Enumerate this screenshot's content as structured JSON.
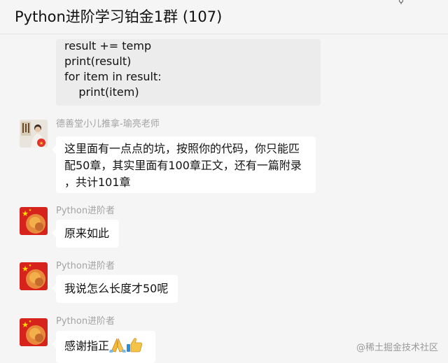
{
  "header": {
    "title": "Python进阶学习铂金1群 (107)"
  },
  "code_message": {
    "lines": [
      "result += temp",
      "print(result)",
      "for item in result:",
      "    print(item)"
    ]
  },
  "messages": [
    {
      "sender": "德善堂小儿推拿-瑜亮老师",
      "lines": [
        "这里面有一点点的坑，按照你的代码，你只能匹",
        "配50章，其实里面有100章正文，还有一篇附录",
        "，共计101章"
      ]
    },
    {
      "sender": "Python进阶者",
      "text": "原来如此"
    },
    {
      "sender": "Python进阶者",
      "text": "我说怎么长度才50呢"
    },
    {
      "sender": "Python进阶者",
      "text": "感谢指正",
      "emojis": [
        "folded-hands-icon",
        "thumbs-up-icon"
      ]
    }
  ],
  "watermark": "@稀土掘金技术社区",
  "colors": {
    "background": "#f5f5f5",
    "bubble": "#ffffff",
    "code_bubble": "#ececec",
    "sender_name": "#a3a3a3"
  }
}
